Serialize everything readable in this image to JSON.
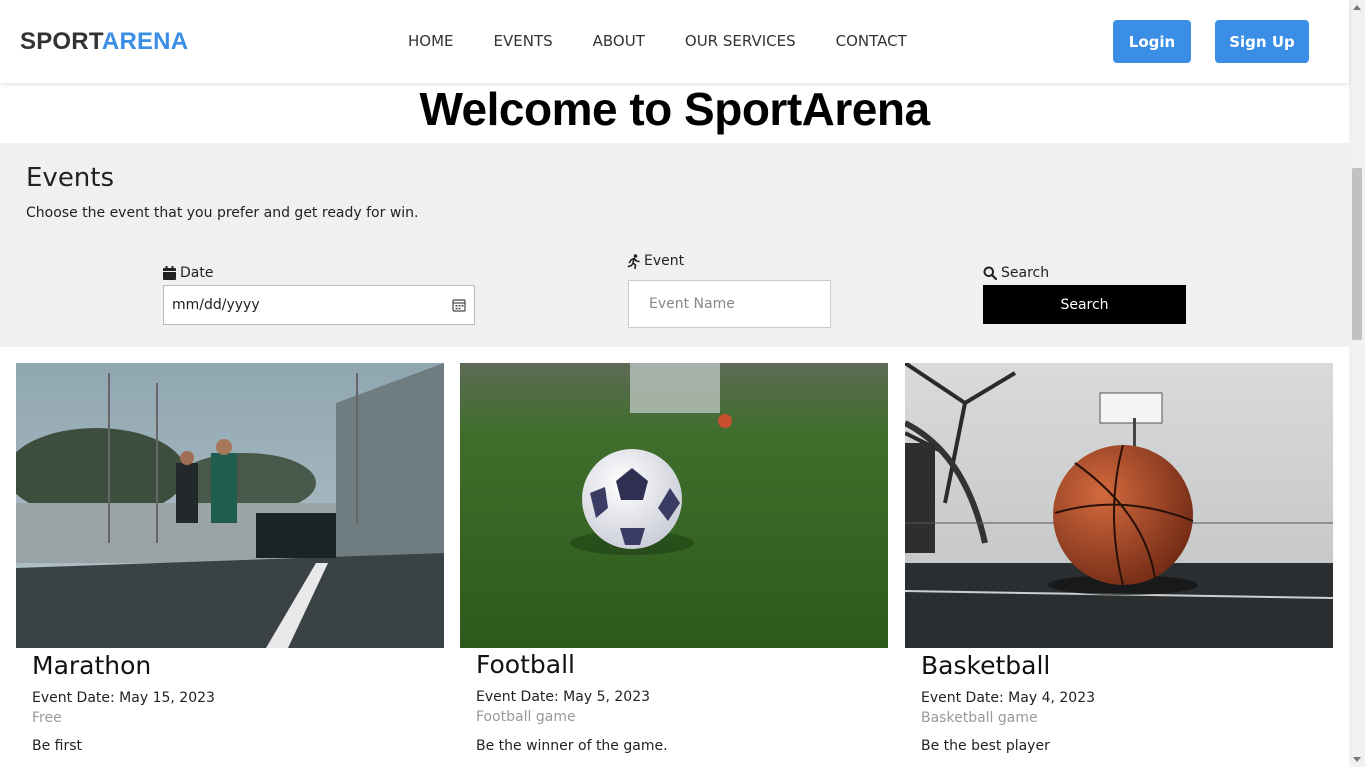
{
  "header": {
    "logo_part1": "SPORT",
    "logo_part2": "ARENA",
    "nav": [
      "HOME",
      "EVENTS",
      "ABOUT",
      "OUR SERVICES",
      "CONTACT"
    ],
    "login_label": "Login",
    "signup_label": "Sign Up"
  },
  "hero": {
    "title": "Welcome to SportArena"
  },
  "events": {
    "heading": "Events",
    "subtitle": "Choose the event that you prefer and get ready for win.",
    "date_label": "Date",
    "date_value": "mm/dd/yyyy",
    "event_label": "Event",
    "event_placeholder": "Event Name",
    "search_label": "Search",
    "search_button": "Search"
  },
  "cards": [
    {
      "title": "Marathon",
      "date": "Event Date: May 15, 2023",
      "category": "Free",
      "description": "Be first"
    },
    {
      "title": "Football",
      "date": "Event Date: May 5, 2023",
      "category": "Football game",
      "description": "Be the winner of the game."
    },
    {
      "title": "Basketball",
      "date": "Event Date: May 4, 2023",
      "category": "Basketball game",
      "description": "Be the best player"
    }
  ],
  "colors": {
    "accent": "#3a8ee6",
    "band": "#f0f0f0",
    "search_button": "#000000"
  },
  "icons": [
    "calendar-icon",
    "runner-icon",
    "search-icon",
    "calendar-picker-icon"
  ]
}
